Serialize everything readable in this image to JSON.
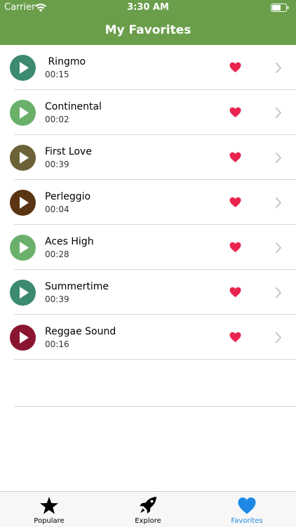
{
  "status_bar": {
    "carrier": "Carrier",
    "time": "3:30 AM"
  },
  "nav": {
    "title": "My Favorites"
  },
  "songs": [
    {
      "title": " Ringmo",
      "duration": "00:15",
      "color": "#3c8a72"
    },
    {
      "title": "Continental",
      "duration": "00:02",
      "color": "#6ab06a"
    },
    {
      "title": "First Love",
      "duration": "00:39",
      "color": "#6b6238"
    },
    {
      "title": "Perleggio",
      "duration": "00:04",
      "color": "#5a3413"
    },
    {
      "title": "Aces High",
      "duration": "00:28",
      "color": "#6ab06a"
    },
    {
      "title": "Summertime",
      "duration": "00:39",
      "color": "#3c8a72"
    },
    {
      "title": "Reggae Sound",
      "duration": "00:16",
      "color": "#8a1530"
    }
  ],
  "colors": {
    "accent": "#6a9e4a",
    "heart": "#e8244f",
    "active_tab": "#1e88e5"
  },
  "tabs": [
    {
      "label": "Populare",
      "icon": "star-icon"
    },
    {
      "label": "Explore",
      "icon": "rocket-icon"
    },
    {
      "label": "Favorites",
      "icon": "heart-icon",
      "active": true
    }
  ]
}
